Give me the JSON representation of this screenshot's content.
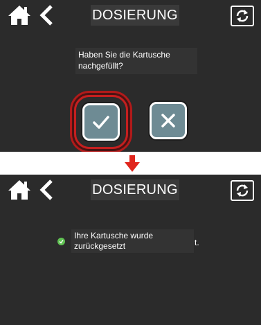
{
  "screens": [
    {
      "header": {
        "title": "DOSIERUNG"
      },
      "dialog": {
        "message": "Haben Sie die Kartusche nachgefüllt?"
      },
      "buttons": {
        "confirm_icon": "checkmark-icon",
        "cancel_icon": "x-icon"
      }
    },
    {
      "header": {
        "title": "DOSIERUNG"
      },
      "notification": {
        "message": "Ihre Kartusche wurde zurückgesetzt",
        "trailing": "t."
      }
    }
  ],
  "colors": {
    "screen_bg": "#2b2b2b",
    "button_fill": "#6e8b94",
    "highlight_ring": "#c51f1f",
    "arrow": "#e0261d",
    "success": "#5fc152"
  },
  "icons": [
    "home-icon",
    "back-chevron-icon",
    "refresh-icon",
    "checkmark-icon",
    "x-icon",
    "down-arrow-icon",
    "success-check-icon"
  ]
}
